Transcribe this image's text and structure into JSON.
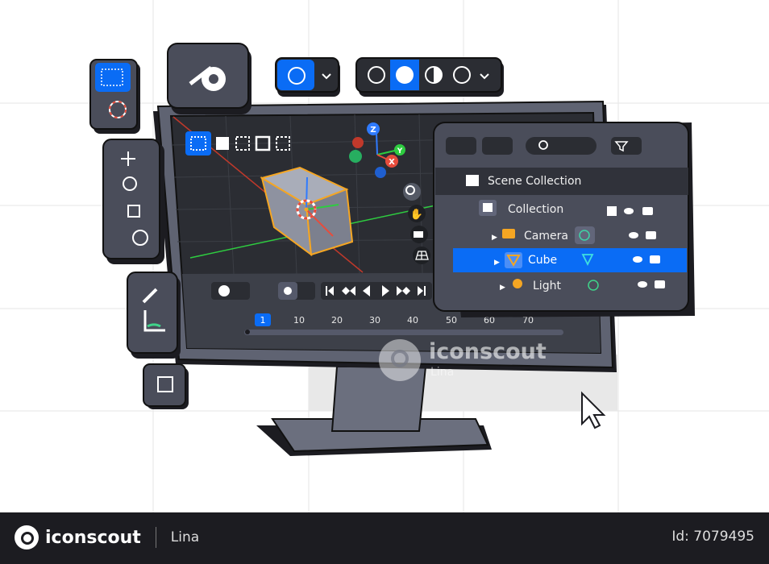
{
  "viewport": {
    "gizmo_axes": [
      "Z",
      "Y",
      "X"
    ],
    "select_modes": [
      "box-select-new",
      "extend",
      "subtract",
      "invert",
      "intersect"
    ],
    "nav_icons": [
      "zoom-icon",
      "pan-hand-icon",
      "camera-view-icon",
      "ortho-grid-icon"
    ]
  },
  "timeline": {
    "current_frame": "1",
    "ticks": [
      "10",
      "20",
      "30",
      "40",
      "50",
      "60",
      "70"
    ]
  },
  "outliner": {
    "scene_collection": "Scene Collection",
    "items": [
      {
        "label": "Collection",
        "icon": "collection-icon",
        "selected": false
      },
      {
        "label": "Camera",
        "icon": "camera-icon",
        "selected": false
      },
      {
        "label": "Cube",
        "icon": "mesh-icon",
        "selected": true
      },
      {
        "label": "Light",
        "icon": "light-icon",
        "selected": false
      }
    ]
  },
  "watermark": {
    "brand": "iconscout",
    "author": "Lina"
  },
  "footer": {
    "brand": "iconscout",
    "author": "Lina",
    "asset_id": "Id: 7079495"
  },
  "colors": {
    "accent": "#0a6cf5",
    "panel": "#4a4d5a",
    "dark": "#2b2d33",
    "selection": "#f5a623"
  }
}
